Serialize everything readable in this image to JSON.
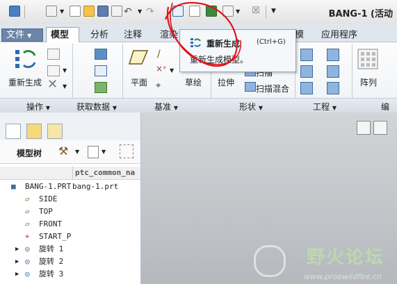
{
  "window": {
    "title": "BANG-1 (活动"
  },
  "tabs": [
    "文件",
    "模型",
    "分析",
    "注释",
    "渲染",
    "模",
    "应用程序"
  ],
  "ribbon": {
    "regenerate_label": "重新生成",
    "plane_label": "平面",
    "sketch_label": "草绘",
    "extrude_label": "拉伸",
    "sweep_label": "扫描",
    "swept_blend_label": "扫描混合",
    "pattern_label": "阵列",
    "groups": [
      "操作",
      "获取数据",
      "基准",
      "形状",
      "工程",
      "编"
    ]
  },
  "tooltip": {
    "title": "重新生成",
    "shortcut": "(Ctrl+G)",
    "description": "重新生成模型。"
  },
  "model_tree": {
    "title": "模型树",
    "column_header": "ptc_common_na",
    "rows": [
      {
        "name": "BANG-1.PRT",
        "value": "bang-1.prt",
        "icon": "part-icon",
        "indent": 0
      },
      {
        "name": "SIDE",
        "value": "",
        "icon": "datum-plane-icon",
        "indent": 1
      },
      {
        "name": "TOP",
        "value": "",
        "icon": "datum-plane-icon",
        "indent": 1
      },
      {
        "name": "FRONT",
        "value": "",
        "icon": "datum-plane-icon",
        "indent": 1
      },
      {
        "name": "START_P",
        "value": "",
        "icon": "csys-icon",
        "indent": 1
      },
      {
        "name": "旋转 1",
        "value": "",
        "icon": "revolve-icon",
        "indent": 1
      },
      {
        "name": "旋转 2",
        "value": "",
        "icon": "revolve-icon",
        "indent": 1
      },
      {
        "name": "旋转 3",
        "value": "",
        "icon": "revolve-icon",
        "indent": 1
      }
    ]
  },
  "watermark": {
    "text": "野火论坛",
    "url": "www.proewildfire.cn"
  },
  "colors": {
    "accent": "#6b86a8",
    "annotation": "#e0141c"
  }
}
